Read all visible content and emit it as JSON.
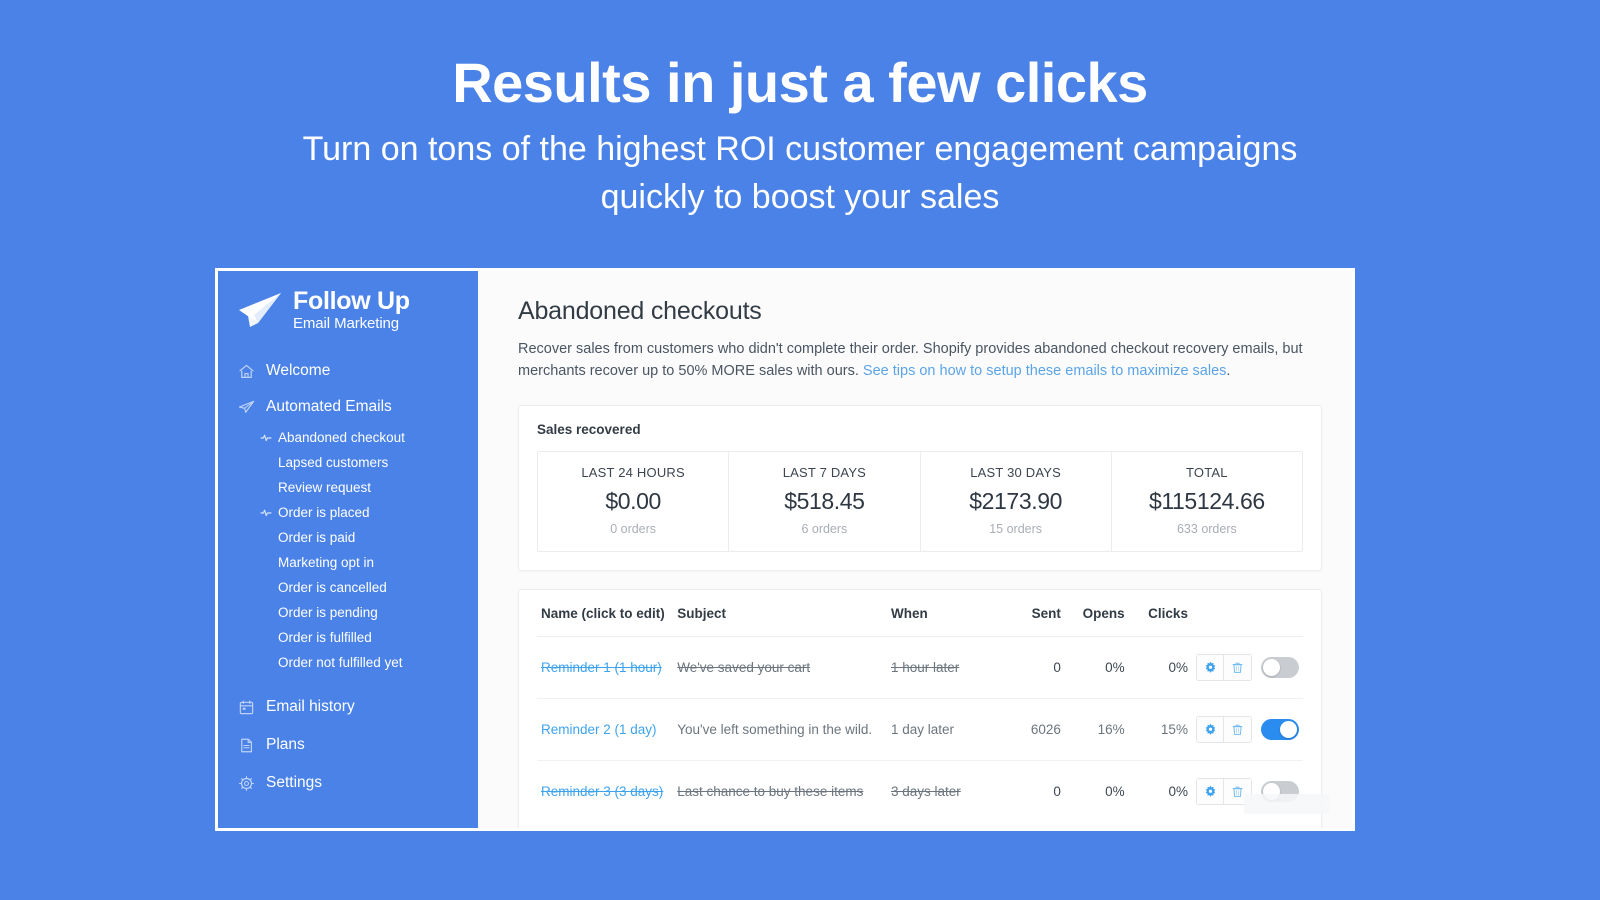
{
  "hero": {
    "title": "Results in just a few clicks",
    "subtitle": "Turn on tons of the highest ROI customer engagement campaigns quickly to boost your sales"
  },
  "colors": {
    "background_blue": "#4A82E8",
    "sidebar_blue": "#4A82E8",
    "link_blue": "#5BA4E8",
    "name_link_blue": "#3EA3EE",
    "toggle_on_blue": "#2B8CF0",
    "toggle_off_gray": "#C9CDD2",
    "icon_blue": "#3EA3EE"
  },
  "sidebar": {
    "logo": {
      "main": "Follow Up",
      "sub": "Email Marketing",
      "icon": "paper-plane-icon"
    },
    "nav": [
      {
        "label": "Welcome",
        "icon": "home-icon"
      },
      {
        "label": "Automated Emails",
        "icon": "paper-plane-icon"
      }
    ],
    "subnav": [
      {
        "label": "Abandoned checkout",
        "bullet": true
      },
      {
        "label": "Lapsed customers",
        "bullet": false
      },
      {
        "label": "Review request",
        "bullet": false
      },
      {
        "label": "Order is placed",
        "bullet": true
      },
      {
        "label": "Order is paid",
        "bullet": false
      },
      {
        "label": "Marketing opt in",
        "bullet": false
      },
      {
        "label": "Order is cancelled",
        "bullet": false
      },
      {
        "label": "Order is pending",
        "bullet": false
      },
      {
        "label": "Order is fulfilled",
        "bullet": false
      },
      {
        "label": "Order not fulfilled yet",
        "bullet": false
      }
    ],
    "nav_bottom": [
      {
        "label": "Email history",
        "icon": "calendar-icon"
      },
      {
        "label": "Plans",
        "icon": "document-icon"
      },
      {
        "label": "Settings",
        "icon": "gear-icon"
      }
    ]
  },
  "main": {
    "title": "Abandoned checkouts",
    "description_before": "Recover sales from customers who didn't complete their order. Shopify provides abandoned checkout recovery emails, but merchants recover up to 50% MORE sales with ours. ",
    "description_link": "See tips on how to setup these emails to maximize sales",
    "description_after": ".",
    "stats": {
      "heading": "Sales recovered",
      "cells": [
        {
          "label": "LAST 24 HOURS",
          "value": "$0.00",
          "sub": "0 orders"
        },
        {
          "label": "LAST 7 DAYS",
          "value": "$518.45",
          "sub": "6 orders"
        },
        {
          "label": "LAST 30 DAYS",
          "value": "$2173.90",
          "sub": "15 orders"
        },
        {
          "label": "TOTAL",
          "value": "$115124.66",
          "sub": "633 orders"
        }
      ]
    },
    "table": {
      "headers": {
        "name": "Name (click to edit)",
        "subject": "Subject",
        "when": "When",
        "sent": "Sent",
        "opens": "Opens",
        "clicks": "Clicks",
        "actions": ""
      },
      "rows": [
        {
          "name": "Reminder 1 (1 hour)",
          "subject": "We've saved your cart",
          "when": "1 hour later",
          "sent": "0",
          "opens": "0%",
          "clicks": "0%",
          "enabled": false
        },
        {
          "name": "Reminder 2 (1 day)",
          "subject": "You've left something in the wild.",
          "when": "1 day later",
          "sent": "6026",
          "opens": "16%",
          "clicks": "15%",
          "enabled": true
        },
        {
          "name": "Reminder 3 (3 days)",
          "subject": "Last chance to buy these items",
          "when": "3 days later",
          "sent": "0",
          "opens": "0%",
          "clicks": "0%",
          "enabled": false
        }
      ],
      "row_actions": {
        "settings_icon": "gear-icon",
        "delete_icon": "trash-icon",
        "toggle": "enable-toggle"
      }
    }
  }
}
